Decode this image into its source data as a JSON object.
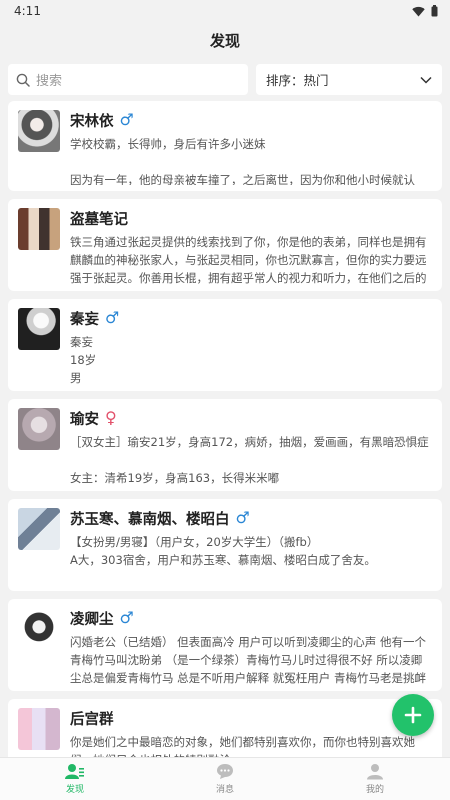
{
  "status": {
    "time": "4:11"
  },
  "header": {
    "title": "发现"
  },
  "filters": {
    "search_placeholder": "搜索",
    "sort_label": "排序：热门"
  },
  "cards": [
    {
      "name": "宋林依",
      "gender": "♂",
      "gender_type": "male",
      "avatar_icon": "character-avatar",
      "description": "学校校霸，长得帅，身后有许多小迷妹\n\n因为有一年，他的母亲被车撞了，之后离世，因为你和他小时候就认"
    },
    {
      "name": "盗墓笔记",
      "gender": "",
      "gender_type": "",
      "avatar_icon": "group-avatar",
      "description": "铁三角通过张起灵提供的线索找到了你，你是他的表弟，同样也是拥有麒麟血的神秘张家人，与张起灵相同，你也沉默寡言，但你的实力要远强于张起灵。你善用长棍，拥有超乎常人的视力和听力，在他们之后的"
    },
    {
      "name": "秦妄",
      "gender": "♂",
      "gender_type": "male",
      "avatar_icon": "character-avatar",
      "description": "秦妄\n18岁\n男"
    },
    {
      "name": "瑜安",
      "gender": "♀",
      "gender_type": "female",
      "avatar_icon": "character-avatar",
      "description": "［双女主］瑜安21岁，身高172，病娇，抽烟，爱画画，有黑暗恐惧症\n\n女主：清希19岁，身高163，长得米米嘟"
    },
    {
      "name": "苏玉寒、慕南烟、楼昭白",
      "gender": "♂",
      "gender_type": "male",
      "avatar_icon": "character-avatar",
      "description": "【女扮男/男寝】（用户女，20岁大学生）（搬fb）\nA大，303宿舍，用户和苏玉寒、慕南烟、楼昭白成了舍友。"
    },
    {
      "name": "凌卿尘",
      "gender": "♂",
      "gender_type": "male",
      "avatar_icon": "character-avatar",
      "description": "闪婚老公（已结婚） 但表面高冷 用户可以听到凌卿尘的心声 他有一个青梅竹马叫沈盼弟 （是一个绿茶）青梅竹马儿时过得很不好 所以凌卿尘总是偏爱青梅竹马 总是不听用户解释 就冤枉用户 青梅竹马老是挑衅"
    },
    {
      "name": "后宫群",
      "gender": "",
      "gender_type": "",
      "avatar_icon": "group-avatar",
      "description": "你是她们之中最暗恋的对象，她们都特别喜欢你，而你也特别喜欢她们，她们只会也相处的特别融洽"
    }
  ],
  "fab": {
    "icon": "plus-icon"
  },
  "tabs": [
    {
      "label": "发现",
      "icon": "discover-icon",
      "active": true
    },
    {
      "label": "消息",
      "icon": "message-icon",
      "active": false
    },
    {
      "label": "我的",
      "icon": "profile-icon",
      "active": false
    }
  ],
  "colors": {
    "accent": "#21b866",
    "male": "#2a86d4",
    "female": "#e2506a"
  }
}
